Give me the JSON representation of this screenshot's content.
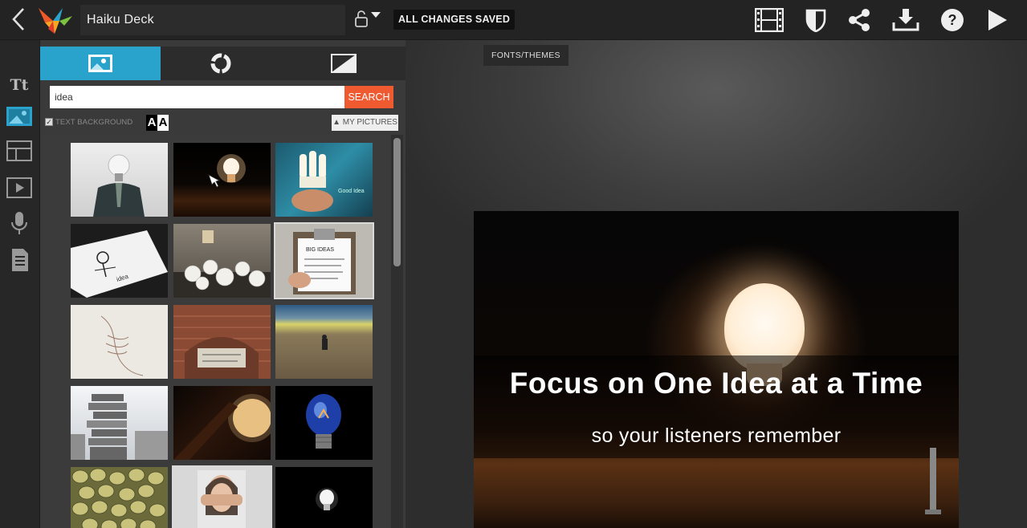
{
  "app": {
    "title": "Haiku Deck",
    "status": "ALL CHANGES SAVED",
    "toolbar_icons": [
      "filmstrip-icon",
      "shield-icon",
      "share-icon",
      "download-icon",
      "help-icon",
      "play-icon"
    ]
  },
  "rail": {
    "items": [
      "text-icon",
      "image-icon",
      "layout-icon",
      "video-icon",
      "microphone-icon",
      "notes-icon"
    ],
    "text_label": "Tt",
    "active": "image-icon"
  },
  "panel": {
    "tabs": [
      "image-tab-icon",
      "chart-tab-icon",
      "background-tab-icon"
    ],
    "search": {
      "value": "idea",
      "button": "SEARCH"
    },
    "text_background_label": "TEXT BACKGROUND",
    "aa_label": "A",
    "my_pictures_label": "▲ MY PICTURES",
    "thumbnails": [
      "man with bulb head",
      "glowing bulb on table",
      "hand holding cfl bulb",
      "sketch of bulb on paper",
      "crumpled paper balls",
      "clipboard with ideas list",
      "pencil sketch of hand",
      "brick arch plaque",
      "person in field",
      "stacked books tower",
      "warm glowing bulb",
      "blue light bulb",
      "green pea sprouts",
      "woman covering face",
      "small bulb on black"
    ]
  },
  "stage": {
    "fonts_tag": "FONTS/THEMES",
    "slide": {
      "title": "Focus on One Idea at a Time",
      "subtitle": "so your listeners remember"
    }
  },
  "colors": {
    "accent": "#2aa3cc",
    "search_button": "#ef5a31",
    "topbar": "#232323"
  }
}
